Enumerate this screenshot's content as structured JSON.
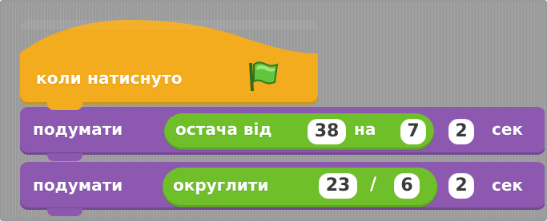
{
  "hat_block": {
    "label": "коли натиснуто",
    "icon": "green-flag-icon"
  },
  "think_block_1": {
    "verb": "подумати",
    "operator": {
      "label_a": "остача від",
      "value_a": "38",
      "label_b": "на",
      "value_b": "7"
    },
    "duration": "2",
    "unit": "сек"
  },
  "think_block_2": {
    "verb": "подумати",
    "operator": {
      "label": "округлити",
      "value_a": "23",
      "symbol": "/",
      "value_b": "6"
    },
    "duration": "2",
    "unit": "сек"
  },
  "colors": {
    "events": "#f2ac1e",
    "looks": "#8c58b0",
    "operators": "#6fbf2b",
    "background": "#9b9b9b"
  }
}
